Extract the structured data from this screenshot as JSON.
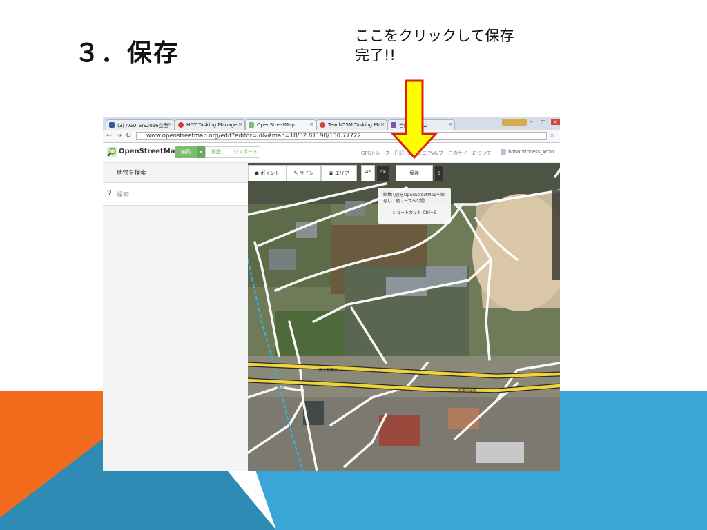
{
  "slide": {
    "title": "３．保存",
    "annotation_line1": "ここをクリックして保存",
    "annotation_line2": "完了!!",
    "colors": {
      "orange": "#f26b1d",
      "blue": "#3aa6d8",
      "steel": "#2e8bb4",
      "arrow_fill": "#ffff00",
      "arrow_stroke": "#e02010"
    }
  },
  "browser": {
    "tabs": [
      {
        "label": "(3) AGU_SIS2016空型",
        "favicon": "facebook-icon",
        "color": "#3b5998"
      },
      {
        "label": "HOT Tasking Manager",
        "favicon": "hot-icon",
        "color": "#d73f3f"
      },
      {
        "label": "OpenStreetMap",
        "favicon": "osm-icon",
        "color": "#7ebc6f"
      },
      {
        "label": "TeachOSM Tasking Ma",
        "favicon": "hot-icon",
        "color": "#d73f3f"
      },
      {
        "label": "合同フォーム",
        "favicon": "form-icon",
        "color": "#7b54b5"
      }
    ],
    "url": "www.openstreetmap.org/edit?editor=id&#map=18/32.81190/130.77722"
  },
  "osm": {
    "logo": "OpenStreetMap",
    "edit_button": "編集",
    "history_button": "履歴",
    "export_button": "エクスポート",
    "links": [
      "GPSトレース",
      "日記",
      "コミュニティ",
      "ヘルプ",
      "このサイトについて"
    ],
    "user": "honoprincess_xoxo",
    "sidebar_title": "地物を検索",
    "search_placeholder": "検索",
    "toolbar": {
      "point": "ポイント",
      "line": "ライン",
      "area": "エリア",
      "undo": "↶",
      "redo": "↷",
      "save": "保存",
      "count": "1"
    },
    "tooltip_text": "編集内容をOpenStreetMapへ保存し、他ユーザへ公開",
    "tooltip_shortcut": "ショートカット Ctrl+S",
    "rail_label_1": "熊本空港線",
    "rail_label_2": "熊本空港線",
    "rail_label_3": "県道"
  }
}
